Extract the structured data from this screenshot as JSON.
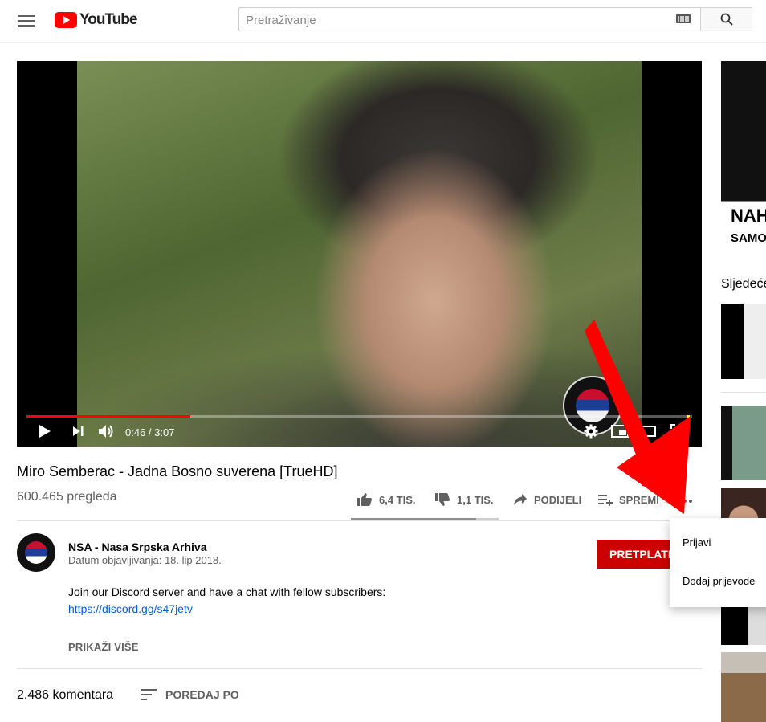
{
  "header": {
    "logo_text": "YouTube",
    "search_placeholder": "Pretraživanje"
  },
  "player": {
    "current_time": "0:46",
    "duration": "3:07",
    "time_display": "0:46 / 3:07",
    "progress_fraction": 0.246
  },
  "video": {
    "title": "Miro Semberac - Jadna Bosno suverena [TrueHD]",
    "views": "600.465 pregleda",
    "likes": "6,4 TIS.",
    "dislikes": "1,1 TIS.",
    "share_label": "PODIJELI",
    "save_label": "SPREMI",
    "like_ratio": 0.85
  },
  "channel": {
    "name": "NSA - Nasa Srpska Arhiva",
    "published": "Datum objavljivanja: 18. lip 2018.",
    "subscribe_label": "PRETPLATI"
  },
  "description": {
    "line1": "Join our Discord server and have a chat with fellow subscribers:",
    "link": "https://discord.gg/s47jetv",
    "show_more": "PRIKAŽI VIŠE"
  },
  "comments": {
    "count": "2.486 komentara",
    "sort_label": "POREDAJ PO"
  },
  "more_menu": {
    "items": [
      "Prijavi",
      "Dodaj prijevode"
    ]
  },
  "sidebar": {
    "next_label": "Sljedeće",
    "thumb1_text1": "NAH",
    "thumb1_text2": "SAMO"
  },
  "colors": {
    "brand_red": "#ff0000",
    "subscribe_red": "#cc0000",
    "link_blue": "#065fd4",
    "annotation_red": "#ff0000"
  }
}
